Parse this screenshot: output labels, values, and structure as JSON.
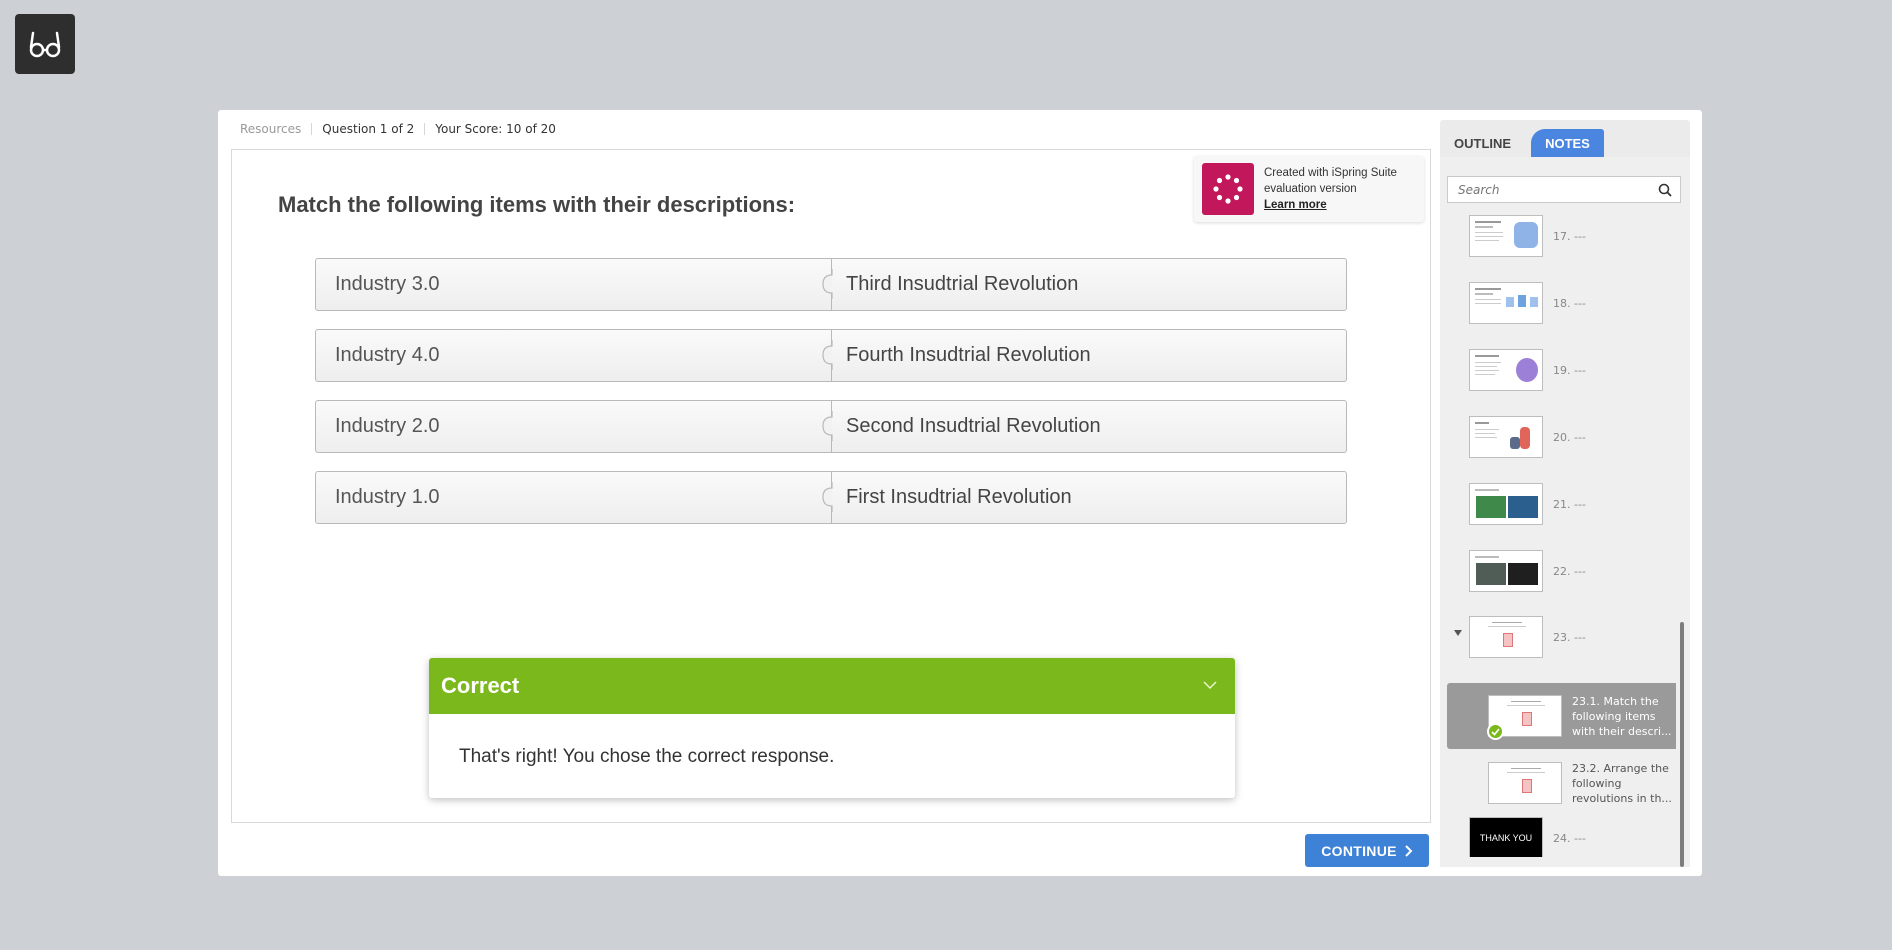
{
  "reader_button": {
    "icon": "glasses-icon"
  },
  "topbar": {
    "resources": "Resources",
    "question_counter": "Question 1 of 2",
    "score": "Your Score: 10 of 20"
  },
  "question": {
    "title": "Match the following items with their descriptions:",
    "pairs": [
      {
        "left": "Industry 3.0",
        "right": "Third Insudtrial Revolution"
      },
      {
        "left": "Industry 4.0",
        "right": "Fourth Insudtrial Revolution"
      },
      {
        "left": "Industry 2.0",
        "right": "Second Insudtrial Revolution"
      },
      {
        "left": "Industry 1.0",
        "right": "First Insudtrial Revolution"
      }
    ]
  },
  "watermark": {
    "line1": "Created with iSpring Suite",
    "line2": "evaluation version",
    "link": "Learn more",
    "brand_color": "#c2185b"
  },
  "feedback": {
    "title": "Correct",
    "message": "That's right! You chose the correct response.",
    "color": "#7bb81c"
  },
  "continue_button": {
    "label": "CONTINUE",
    "color": "#3e82d8"
  },
  "sidebar": {
    "tabs": [
      {
        "label": "OUTLINE",
        "active": false
      },
      {
        "label": "NOTES",
        "active": true
      }
    ],
    "search_placeholder": "Search",
    "items": [
      {
        "label": "17. ---"
      },
      {
        "label": "18. ---"
      },
      {
        "label": "19. ---"
      },
      {
        "label": "20. ---"
      },
      {
        "label": "21. ---"
      },
      {
        "label": "22. ---"
      },
      {
        "label": "23. ---",
        "expanded": true
      },
      {
        "label": "24. ---",
        "thumb_text": "THANK YOU"
      }
    ],
    "subitems": [
      {
        "label": "23.1. Match the following items with their descri...",
        "selected": true,
        "completed": true
      },
      {
        "label": "23.2.  Arrange the following revolutions in th...",
        "selected": false,
        "completed": false
      }
    ]
  }
}
